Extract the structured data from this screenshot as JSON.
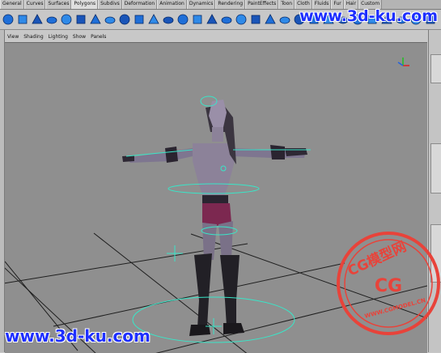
{
  "shelf_tabs": [
    "General",
    "Curves",
    "Surfaces",
    "Polygons",
    "Subdivs",
    "Deformation",
    "Animation",
    "Dynamics",
    "Rendering",
    "PaintEffects",
    "Toon",
    "Cloth",
    "Fluids",
    "Fur",
    "Hair",
    "Custom"
  ],
  "active_shelf_tab": "Polygons",
  "panel_menu": [
    "View",
    "Shading",
    "Lighting",
    "Show",
    "Panels"
  ],
  "watermark_top": "www.3d-ku.com",
  "watermark_bottom": "www.3d-ku.com",
  "stamp": {
    "text": "CG模型网",
    "center": "CG",
    "url": "WWW.CGMODEL.CN"
  },
  "colors": {
    "viewport_bg": "#8f8f8f",
    "grid": "#1e1e1e",
    "selection": "#39e6c8",
    "stamp": "#e8433a",
    "watermark": "#1e2fff"
  }
}
